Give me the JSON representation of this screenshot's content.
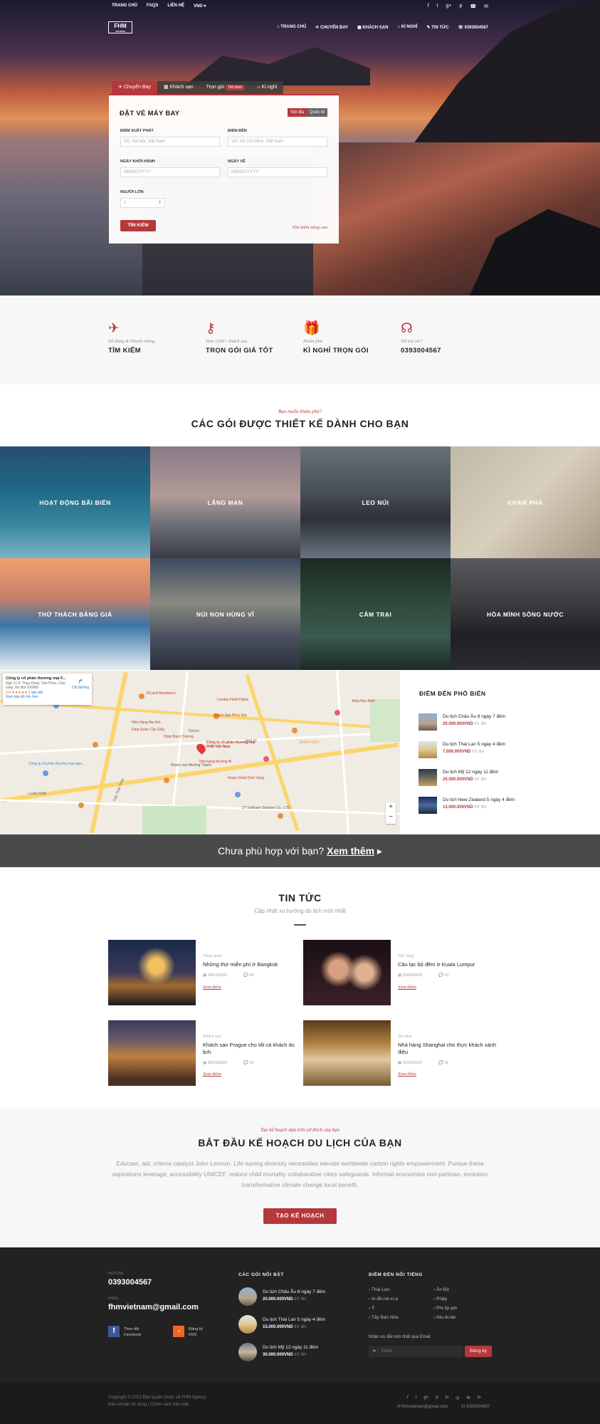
{
  "topbar": {
    "links": [
      "TRANG CHỦ",
      "FAQS",
      "LIÊN HỆ",
      "VND"
    ],
    "social": [
      "f",
      "t",
      "g+",
      "p",
      "☎",
      "✉"
    ]
  },
  "logo": {
    "main": "FHM",
    "sub": "VIETNAM"
  },
  "nav": [
    "TRANG CHỦ",
    "CHUYẾN BAY",
    "KHÁCH SẠN",
    "KÌ NGHỈ",
    "TIN TỨC",
    "0393004567"
  ],
  "search_tabs": [
    "Chuyến Bay",
    "Khách sạn",
    "Trọn gói",
    "Tiết kiệm",
    "Kì nghỉ"
  ],
  "booking": {
    "title": "ĐẶT VÉ MÁY BAY",
    "toggle": [
      "Nội địa",
      "Quốc tế"
    ],
    "from_label": "ĐIỂM XUẤT PHÁT",
    "from_ph": "VD: Hà Nội, Việt Nam",
    "to_label": "ĐIỂM ĐẾN",
    "to_ph": "VD: Hồ Chí Minh, Việt Nam",
    "depart_label": "NGÀY KHỞI HÀNH",
    "depart_ph": "MM/DD/YYYY",
    "return_label": "NGÀY VỀ",
    "return_ph": "MM/DD/YYYY",
    "people_label": "NGƯỜI LỚN",
    "people_value": "2",
    "search_btn": "TÌM KIẾM",
    "advanced": "Tìm kiếm nâng cao"
  },
  "features": [
    {
      "icon": "plane-icon",
      "glyph": "✈",
      "small": "Dễ dàng & Nhanh chóng",
      "big": "TÌM KIẾM"
    },
    {
      "icon": "key-icon",
      "glyph": "⚷",
      "small": "Hơn 1500+ khách sạn",
      "big": "TRỌN GÓI GIÁ TỐT"
    },
    {
      "icon": "gift-icon",
      "glyph": "🎁",
      "small": "Khám phá",
      "big": "KÌ NGHỈ TRỌN GÓI"
    },
    {
      "icon": "headset-icon",
      "glyph": "☊",
      "small": "Hỗ trợ 24/7",
      "big": "0393004567"
    }
  ],
  "packages": {
    "small": "Bạn muốn khám phá?",
    "title": "CÁC GÓI ĐƯỢC THIẾT KẾ DÀNH CHO BẠN",
    "tiles": [
      "HOẠT ĐỘNG BÃI BIỂN",
      "LÃNG MẠN",
      "LEO NÚI",
      "KHÁM PHÁ",
      "THỬ THÁCH BĂNG GIÁ",
      "NÚI NON HÙNG VĨ",
      "CẮM TRẠI",
      "HÒA MÌNH SÔNG NƯỚC"
    ]
  },
  "map": {
    "place_name": "Công ty cổ phần thương mại F...",
    "place_addr": "Ngõ 21 P. Thụy Khuê, Vạn Phúc, Cầu Giấy, Hà Nội 100000",
    "rating": "5.0 ★★★★★",
    "reviews": "1 bài viết",
    "larger": "Xem bản đồ lớn hơn",
    "directions": "Chỉ đường",
    "marker": "Công ty cổ phần thương mại FHM Việt Nam",
    "labels": [
      "22Land Residence",
      "London Hotel Hanoi",
      "Khách Sạn Phúc Gia",
      "Hotel Bạch Dương",
      "Nature",
      "Ngõ 21",
      "Nhà Hàng Bia Hơi",
      "Ding Quán Cầu Giấy",
      "ZERO FOOT",
      "Bida Bạc Bình",
      "King's Hotel Dịch Vọng",
      "Nhà hàng Mường Bi",
      "Trần Thái Tông",
      "Lucky Club",
      "Công ty cổ phần thương mại ngoi...",
      "2T Software Solution Co., LTD",
      "Khách sạn Mường Thanh"
    ]
  },
  "destinations": {
    "title": "ĐIỂM ĐẾN PHỔ BIẾN",
    "items": [
      {
        "name": "Du lịch Châu Âu 8 ngày 7 đêm",
        "price": "20.000.000VND",
        "suffix": "trở lên"
      },
      {
        "name": "Du lịch Thái Lan 5 ngày 4 đêm",
        "price": "7.000.000VND",
        "suffix": "trở lên"
      },
      {
        "name": "Du lịch Mỹ 12 ngày 11 đêm",
        "price": "25.000.000VND",
        "suffix": "trở lên"
      },
      {
        "name": "Du lịch New Zealand 5 ngày 4 đêm",
        "price": "12.000.000VND",
        "suffix": "trở lên"
      }
    ]
  },
  "cta": {
    "text": "Chưa phù hợp với bạn?",
    "link": "Xem thêm"
  },
  "news": {
    "title": "TIN TỨC",
    "subtitle": "Cập nhật xu hướng du lịch mới nhất",
    "items": [
      {
        "cat": "Tham quan",
        "title": "Những thứ miễn phí ở Bangkok",
        "date": "16/01/2022",
        "comments": "25",
        "more": "Xem thêm"
      },
      {
        "cat": "Tiệc tùng",
        "title": "Câu lạc bộ đêm ở Kuala Lumpur",
        "date": "21/06/2022",
        "comments": "12",
        "more": "Xem thêm"
      },
      {
        "cat": "Khách sạn",
        "title": "Khách sạn Prague cho tất cả khách du lịch",
        "date": "02/03/2022",
        "comments": "19",
        "more": "Xem thêm"
      },
      {
        "cat": "Ẩm thực",
        "title": "Nhà hàng Shanghai cho thực khách sành điệu",
        "date": "11/02/2022",
        "comments": "11",
        "more": "Xem thêm"
      }
    ]
  },
  "plan": {
    "small": "Tạo kế hoạch dựa trên sở thích của bạn",
    "title": "BẮT ĐẦU KẾ HOẠCH DU LỊCH CỦA BẠN",
    "body": "Educate, aid, criteria catalyst John Lennon. Life-saving diversity necessities elevate worldwide carbon rights empowerment. Pursue these aspirations leverage, accessibility UNICEF, reduce child mortality collaborative cities safeguards. Informal economies non-partisan, evolution transformative climate change local benefit.",
    "button": "TẠO KẾ HOẠCH"
  },
  "footer": {
    "phone_label": "HOTLINE",
    "phone": "0393004567",
    "email_label": "EMAIL",
    "email": "fhmvietnam@gmail.com",
    "fb": [
      "Theo dõi",
      "Facebook"
    ],
    "rss": [
      "Đăng ký",
      "RSS"
    ],
    "packages_title": "CÁC GÓI NỔI BẬT",
    "packages": [
      {
        "name": "Du lịch Châu Âu 8 ngày 7 đêm",
        "price": "20.000.000VND",
        "suffix": "trở lên"
      },
      {
        "name": "Du lịch Thái Lan 5 ngày 4 đêm",
        "price": "15.000.000VND",
        "suffix": "trở lên"
      },
      {
        "name": "Du lịch Mỹ 12 ngày 11 đêm",
        "price": "30.000.000VND",
        "suffix": "trở lên"
      }
    ],
    "dest_title": "ĐIỂM ĐẾN NỔI TIẾNG",
    "dest_col1": [
      "Thái Lan",
      "In-đô-nê-xi-a",
      "Ý",
      "Tây Ban Nha"
    ],
    "dest_col2": [
      "Ấn Độ",
      "Pháp",
      "Phi-líp-pin",
      "Niu-di-lân"
    ],
    "newsletter": "Nhận ưu đãi mới nhất qua Email",
    "email_ph": "Email",
    "subscribe": "Đăng ký"
  },
  "bottom": {
    "copyright": "Copyright © 2022 Bản quyền thuộc về FHM Agency",
    "links": "Điều khoản sử dụng  /  Chính sách bảo mật",
    "email": "fhmvietnam@gmail.com",
    "phone": "0393004567",
    "social": [
      "f",
      "t",
      "g+",
      "p",
      "in",
      "◎",
      "✉",
      "in"
    ]
  },
  "colors": {
    "accent": "#b5383c",
    "dark": "#222222"
  }
}
